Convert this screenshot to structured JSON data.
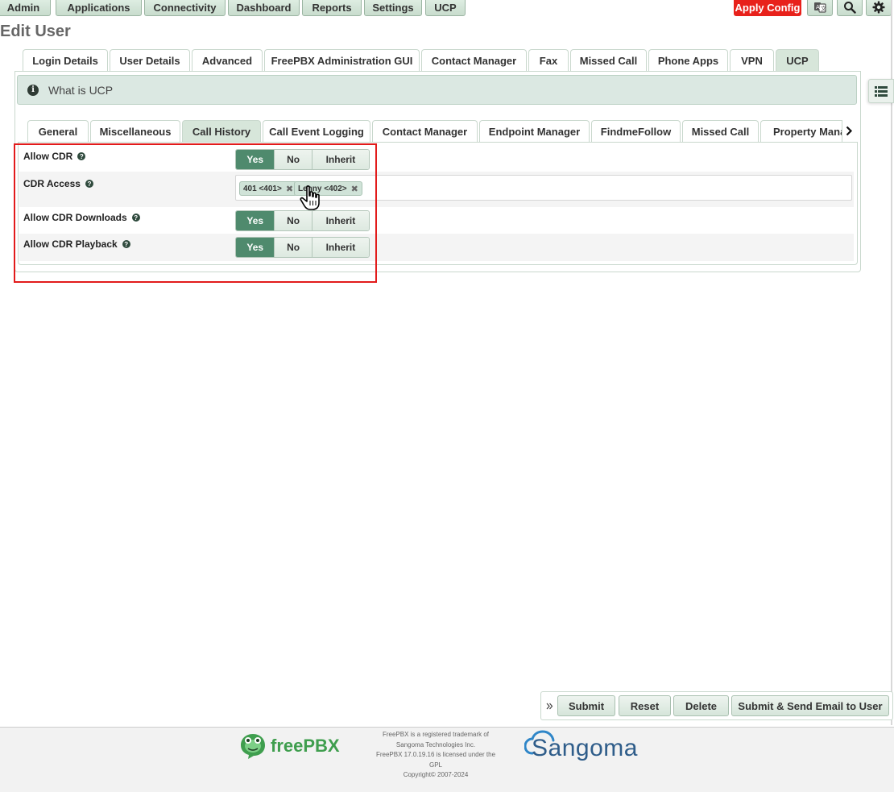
{
  "nav": {
    "items": [
      "Admin",
      "Applications",
      "Connectivity",
      "Dashboard",
      "Reports",
      "Settings",
      "UCP"
    ],
    "apply_config": "Apply Config",
    "icons": [
      "translate-icon",
      "search-icon",
      "gear-icon"
    ]
  },
  "page": {
    "title": "Edit User"
  },
  "outer_tabs": {
    "items": [
      "Login Details",
      "User Details",
      "Advanced",
      "FreePBX Administration GUI",
      "Contact Manager",
      "Fax",
      "Missed Call",
      "Phone Apps",
      "VPN",
      "UCP"
    ],
    "active": "UCP"
  },
  "info": {
    "label": "What is UCP"
  },
  "inner_tabs": {
    "items": [
      "General",
      "Miscellaneous",
      "Call History",
      "Call Event Logging",
      "Contact Manager",
      "Endpoint Manager",
      "FindmeFollow",
      "Missed Call",
      "Property Mana"
    ],
    "active": "Call History"
  },
  "form": {
    "allow_cdr": {
      "label": "Allow CDR",
      "options": [
        "Yes",
        "No",
        "Inherit"
      ],
      "selected": "Yes"
    },
    "cdr_access": {
      "label": "CDR Access",
      "values": [
        "401 <401>",
        "Lenny <402>"
      ]
    },
    "allow_cdr_downloads": {
      "label": "Allow CDR Downloads",
      "options": [
        "Yes",
        "No",
        "Inherit"
      ],
      "selected": "Yes"
    },
    "allow_cdr_playback": {
      "label": "Allow CDR Playback",
      "options": [
        "Yes",
        "No",
        "Inherit"
      ],
      "selected": "Yes"
    }
  },
  "actions": {
    "submit": "Submit",
    "reset": "Reset",
    "delete": "Delete",
    "submit_send": "Submit & Send Email to User"
  },
  "footer": {
    "freepbx_logo_text": "freePBX",
    "legal_lines": [
      "FreePBX is a registered trademark of",
      "Sangoma Technologies Inc.",
      "FreePBX 17.0.19.16 is licensed under the",
      "GPL",
      "Copyright© 2007-2024"
    ],
    "sangoma_logo_text": "Sangoma"
  },
  "colors": {
    "accent": "#4f8a6d",
    "apply": "#e8211b",
    "highlight": "#e21b1b"
  }
}
